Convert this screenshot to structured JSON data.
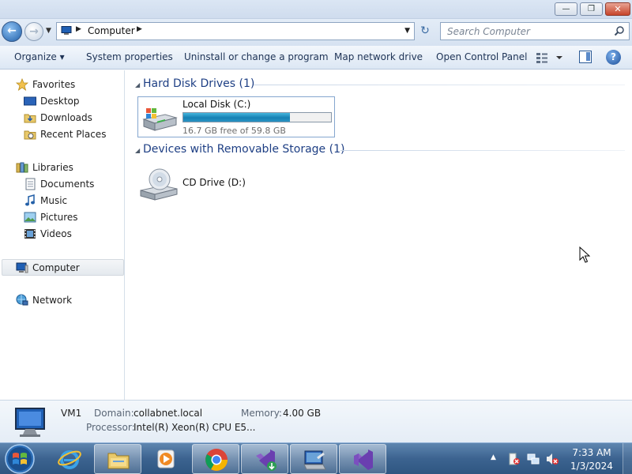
{
  "window": {
    "minimize_glyph": "—",
    "restore_glyph": "❐",
    "close_glyph": "✕"
  },
  "address": {
    "location": "Computer",
    "search_placeholder": "Search Computer"
  },
  "toolbar": {
    "organize": "Organize ▾",
    "system_properties": "System properties",
    "uninstall": "Uninstall or change a program",
    "map_network_drive": "Map network drive",
    "open_control_panel": "Open Control Panel"
  },
  "nav": {
    "favorites": "Favorites",
    "desktop": "Desktop",
    "downloads": "Downloads",
    "recent_places": "Recent Places",
    "libraries": "Libraries",
    "documents": "Documents",
    "music": "Music",
    "pictures": "Pictures",
    "videos": "Videos",
    "computer": "Computer",
    "network": "Network"
  },
  "content": {
    "hard_disk_group": "Hard Disk Drives (1)",
    "removable_group": "Devices with Removable Storage (1)",
    "local_disk": {
      "name": "Local Disk (C:)",
      "free_text": "16.7 GB free of 59.8 GB",
      "used_fraction": 0.72
    },
    "cd_drive": {
      "name": "CD Drive (D:)"
    }
  },
  "details": {
    "name": "VM1",
    "domain_label": "Domain:",
    "domain_value": "collabnet.local",
    "memory_label": "Memory:",
    "memory_value": "4.00 GB",
    "processor_label": "Processor:",
    "processor_value": "Intel(R) Xeon(R) CPU E5..."
  },
  "taskbar": {
    "time": "7:33 AM",
    "date": "1/3/2024",
    "apps": [
      "internet-explorer",
      "windows-explorer",
      "media-player",
      "chrome",
      "visual-studio-installer",
      "computer-management",
      "visual-studio"
    ]
  },
  "colors": {
    "disk_bar": "#1680b3",
    "group_header": "#1e3f84",
    "taskbar": "#3c6390"
  }
}
